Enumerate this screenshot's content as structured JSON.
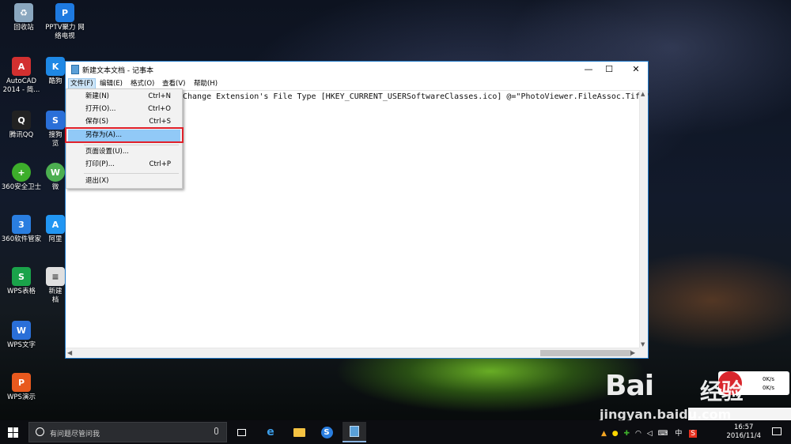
{
  "desktop": {
    "icons": [
      {
        "label": "回收站",
        "label2": "",
        "color": "#8aa7bf",
        "glyph": "♻"
      },
      {
        "label": "PPTV聚力 网",
        "label2": "络电视",
        "color": "#1e7ae0",
        "glyph": "P"
      },
      {
        "label": "AutoCAD",
        "label2": "2014 - 简...",
        "color": "#d23030",
        "glyph": "A"
      },
      {
        "label": "酷狗",
        "label2": "",
        "color": "#1e88e5",
        "glyph": "K"
      },
      {
        "label": "腾讯QQ",
        "label2": "",
        "color": "#222222",
        "glyph": "Q"
      },
      {
        "label": "搜狗",
        "label2": "览",
        "color": "#2a6fd8",
        "glyph": "S"
      },
      {
        "label": "360安全卫士",
        "label2": "",
        "color": "#3dae2b",
        "glyph": "+"
      },
      {
        "label": "微",
        "label2": "",
        "color": "#4caf50",
        "glyph": "W"
      },
      {
        "label": "360软件管家",
        "label2": "",
        "color": "#2a7ee0",
        "glyph": "3"
      },
      {
        "label": "阿里",
        "label2": "",
        "color": "#2196f3",
        "glyph": "A"
      },
      {
        "label": "WPS表格",
        "label2": "",
        "color": "#1aa34a",
        "glyph": "S"
      },
      {
        "label": "新建",
        "label2": "档",
        "color": "#e0e0e0",
        "glyph": "≡"
      },
      {
        "label": "WPS文字",
        "label2": "",
        "color": "#2a6fd8",
        "glyph": "W"
      },
      {
        "label": "WPS演示",
        "label2": "",
        "color": "#e8591e",
        "glyph": "P"
      }
    ]
  },
  "window": {
    "title": "新建文本文档 - 记事本",
    "controls": {
      "minimize": "—",
      "maximize": "☐",
      "close": "✕"
    },
    "menus": [
      "文件(F)",
      "编辑(E)",
      "格式(O)",
      "查看(V)",
      "帮助(H)"
    ],
    "content": "Change Extension's File Type [HKEY_CURRENT_USERSoftwareClasses.ico] @=\"PhotoViewer.FileAssoc.Tiff\""
  },
  "file_menu": {
    "items": [
      {
        "label": "新建(N)",
        "shortcut": "Ctrl+N"
      },
      {
        "label": "打开(O)...",
        "shortcut": "Ctrl+O"
      },
      {
        "label": "保存(S)",
        "shortcut": "Ctrl+S"
      },
      {
        "label": "另存为(A)...",
        "shortcut": ""
      },
      {
        "label": "页面设置(U)...",
        "shortcut": ""
      },
      {
        "label": "打印(P)...",
        "shortcut": "Ctrl+P"
      },
      {
        "label": "退出(X)",
        "shortcut": ""
      }
    ],
    "highlighted_index": 3
  },
  "taskbar": {
    "search_placeholder": "有问题尽管问我",
    "tray_lang": "中",
    "time": "16:57",
    "date": "2016/11/4"
  },
  "watermark": {
    "brand": "Bai",
    "brand2": "经验",
    "url": "jingyan.baidu.com"
  },
  "net_widget": {
    "up": "0K/s",
    "down": "0K/s"
  },
  "colors": {
    "accent": "#1e78c8",
    "highlight": "#91c9f7",
    "red_box": "#e0202a"
  }
}
